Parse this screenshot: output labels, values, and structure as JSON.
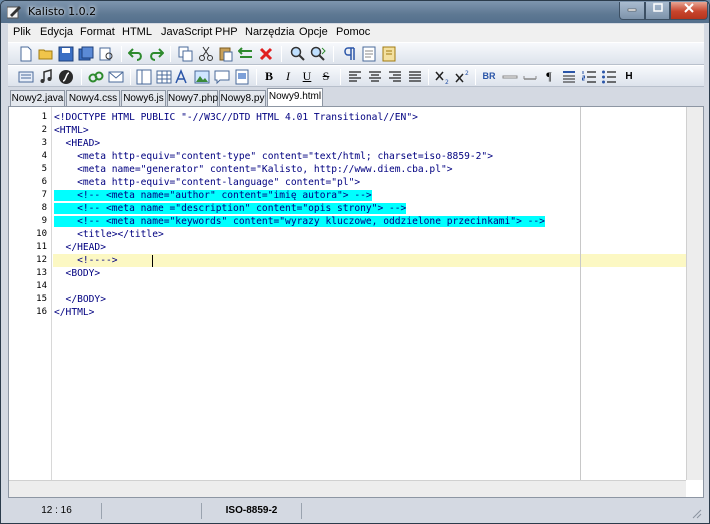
{
  "window": {
    "title": "Kalisto   1.0.2"
  },
  "menu": {
    "items": [
      "Plik",
      "Edycja",
      "Format",
      "HTML",
      "JavaScript",
      "PHP",
      "Narzędzia",
      "Opcje",
      "Pomoc"
    ]
  },
  "toolbar2": {
    "br_label": "BR",
    "h_label": "H"
  },
  "tabs": [
    "Nowy2.java",
    "Nowy4.css",
    "Nowy6.js",
    "Nowy7.php",
    "Nowy8.py",
    "Nowy9.html"
  ],
  "editor": {
    "line_numbers": [
      "1",
      "2",
      "3",
      "4",
      "5",
      "6",
      "7",
      "8",
      "9",
      "10",
      "11",
      "12",
      "13",
      "14",
      "15",
      "16"
    ],
    "lines": [
      "<!DOCTYPE HTML PUBLIC \"-//W3C//DTD HTML 4.01 Transitional//EN\">",
      "<HTML>",
      "  <HEAD>",
      "    <meta http-equiv=\"content-type\" content=\"text/html; charset=iso-8859-2\">",
      "    <meta name=\"generator\" content=\"Kalisto, http://www.diem.cba.pl\">",
      "    <meta http-equiv=\"content-language\" content=\"pl\">",
      "    <!-- <meta name=\"author\" content=\"imię autora\"> -->",
      "    <!-- <meta name =\"description\" content=\"opis strony\"> -->",
      "    <!-- <meta name=\"keywords\" content=\"wyrazy kluczowe, oddzielone przecinkami\"> -->",
      "    <title></title>",
      "  </HEAD>",
      "    <!---->  ",
      "  <BODY>",
      "",
      "  </BODY>",
      "</HTML>"
    ]
  },
  "status": {
    "position": "12 : 16",
    "encoding": "ISO-8859-2"
  }
}
